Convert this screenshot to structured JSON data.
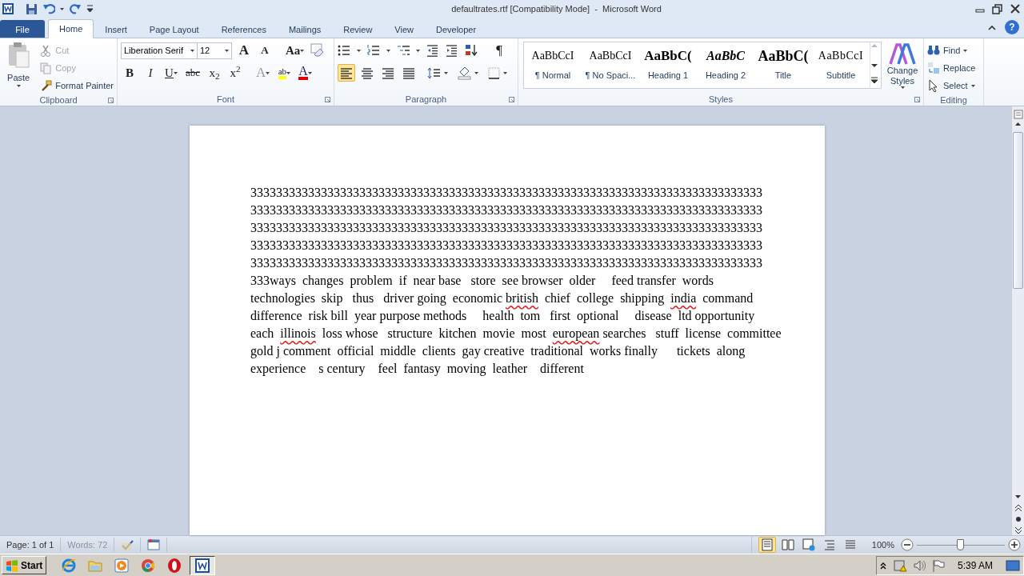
{
  "window": {
    "title": "defaultrates.rtf [Compatibility Mode]  -  Microsoft Word"
  },
  "tabs": [
    {
      "label": "File",
      "kind": "file",
      "selected": false
    },
    {
      "label": "Home",
      "kind": "tab",
      "selected": true
    },
    {
      "label": "Insert",
      "kind": "tab",
      "selected": false
    },
    {
      "label": "Page Layout",
      "kind": "tab",
      "selected": false
    },
    {
      "label": "References",
      "kind": "tab",
      "selected": false
    },
    {
      "label": "Mailings",
      "kind": "tab",
      "selected": false
    },
    {
      "label": "Review",
      "kind": "tab",
      "selected": false
    },
    {
      "label": "View",
      "kind": "tab",
      "selected": false
    },
    {
      "label": "Developer",
      "kind": "tab",
      "selected": false
    }
  ],
  "help": "?",
  "clipboard": {
    "paste": "Paste",
    "group": "Clipboard",
    "items": [
      {
        "kind": "cut",
        "label": "Cut",
        "disabled": true
      },
      {
        "kind": "copy",
        "label": "Copy",
        "disabled": true
      },
      {
        "kind": "format_painter",
        "label": "Format Painter",
        "disabled": false
      }
    ]
  },
  "font": {
    "font_name": "Liberation Serif",
    "font_size": "12",
    "group": "Font",
    "top_buttons": [
      {
        "kind": "grow",
        "label": "A",
        "disabled": false
      },
      {
        "kind": "shrink",
        "label": "A",
        "disabled": false
      },
      {
        "kind": "change_case",
        "label": "Aa",
        "disabled": false
      }
    ],
    "buttons": [
      {
        "kind": "bold",
        "label": "B",
        "disabled": false
      },
      {
        "kind": "italic",
        "label": "I",
        "disabled": false
      },
      {
        "kind": "underline",
        "label": "U",
        "disabled": false
      },
      {
        "kind": "strike",
        "label": "abc",
        "disabled": false
      },
      {
        "kind": "subscript",
        "label": "x$_{2}$",
        "disabled": false
      },
      {
        "kind": "superscript",
        "label": "x$^{2}$",
        "disabled": false
      },
      {
        "kind": "text_effects",
        "label": "A",
        "disabled": true
      },
      {
        "kind": "highlight",
        "label": "ab",
        "disabled": false
      },
      {
        "kind": "font_color",
        "label": "A",
        "disabled": false
      }
    ]
  },
  "paragraph": {
    "group": "Paragraph",
    "pilcrow": "¶",
    "align": [
      {
        "kind": "left",
        "selected": true
      },
      {
        "kind": "center",
        "selected": false
      },
      {
        "kind": "right",
        "selected": false
      },
      {
        "kind": "justify",
        "selected": false
      }
    ]
  },
  "styles": {
    "group": "Styles",
    "change_styles": "Change Styles",
    "items": [
      {
        "kind": "normal",
        "sample": "AaBbCcI",
        "label": "¶ Normal"
      },
      {
        "kind": "no_spacing",
        "sample": "AaBbCcI",
        "label": "¶ No Spaci..."
      },
      {
        "kind": "heading1",
        "sample": "AaBbC(",
        "label": "Heading 1"
      },
      {
        "kind": "heading2",
        "sample": "AaBbC",
        "label": "Heading 2"
      },
      {
        "kind": "title",
        "sample": "AaBbC(",
        "label": "Title"
      },
      {
        "kind": "subtitle",
        "sample": "AaBbCcI",
        "label": "Subtitle"
      }
    ]
  },
  "editing": {
    "group": "Editing",
    "items": [
      {
        "kind": "find",
        "label": "Find"
      },
      {
        "kind": "replace",
        "label": "Replace"
      },
      {
        "kind": "select",
        "label": "Select"
      }
    ]
  },
  "document": {
    "lines": [
      [
        {
          "text": "33333333333333333333333333333333333333333333333333333333333333333333333333333333",
          "misspelled": false
        }
      ],
      [
        {
          "text": "33333333333333333333333333333333333333333333333333333333333333333333333333333333",
          "misspelled": false
        }
      ],
      [
        {
          "text": "33333333333333333333333333333333333333333333333333333333333333333333333333333333",
          "misspelled": false
        }
      ],
      [
        {
          "text": "33333333333333333333333333333333333333333333333333333333333333333333333333333333",
          "misspelled": false
        }
      ],
      [
        {
          "text": "33333333333333333333333333333333333333333333333333333333333333333333333333333333",
          "misspelled": false
        }
      ],
      [
        {
          "text": "333ways  changes  problem  if  near base   store  see browser  older     feed transfer  words",
          "misspelled": false
        }
      ],
      [
        {
          "text": "technologies  skip   thus   driver going  economic ",
          "misspelled": false
        },
        {
          "text": "british",
          "misspelled": true
        },
        {
          "text": "  chief  college  shipping  ",
          "misspelled": false
        },
        {
          "text": "india",
          "misspelled": true
        },
        {
          "text": "  command",
          "misspelled": false
        }
      ],
      [
        {
          "text": "difference  risk bill  year purpose methods     health  tom   first  optional     disease  ltd opportunity",
          "misspelled": false
        }
      ],
      [
        {
          "text": "each  ",
          "misspelled": false
        },
        {
          "text": "illinois",
          "misspelled": true
        },
        {
          "text": "  loss whose   structure  kitchen  movie  most  ",
          "misspelled": false
        },
        {
          "text": "european",
          "misspelled": true
        },
        {
          "text": " searches   stuff  license  committee",
          "misspelled": false
        }
      ],
      [
        {
          "text": "gold j comment  official  middle  clients  gay creative  traditional  works finally      tickets  along",
          "misspelled": false
        }
      ],
      [
        {
          "text": "experience    s century    feel  fantasy  moving  leather    different",
          "misspelled": false
        }
      ]
    ]
  },
  "status_bar": {
    "page": "Page: 1 of 1",
    "words": "Words: 72",
    "zoom": "100%",
    "zoom_slider": {
      "level": 0.5
    },
    "views": [
      {
        "kind": "print",
        "selected": true
      },
      {
        "kind": "reading",
        "selected": false
      },
      {
        "kind": "web",
        "selected": false
      },
      {
        "kind": "outline",
        "selected": false
      },
      {
        "kind": "draft",
        "selected": false
      }
    ]
  },
  "taskbar": {
    "start": "Start",
    "clock": "5:39 AM",
    "items": [
      {
        "kind": "ie",
        "selected": false
      },
      {
        "kind": "folder",
        "selected": false
      },
      {
        "kind": "media",
        "selected": false
      },
      {
        "kind": "chrome",
        "selected": false
      },
      {
        "kind": "opera",
        "selected": false
      },
      {
        "kind": "word",
        "selected": true
      }
    ]
  }
}
